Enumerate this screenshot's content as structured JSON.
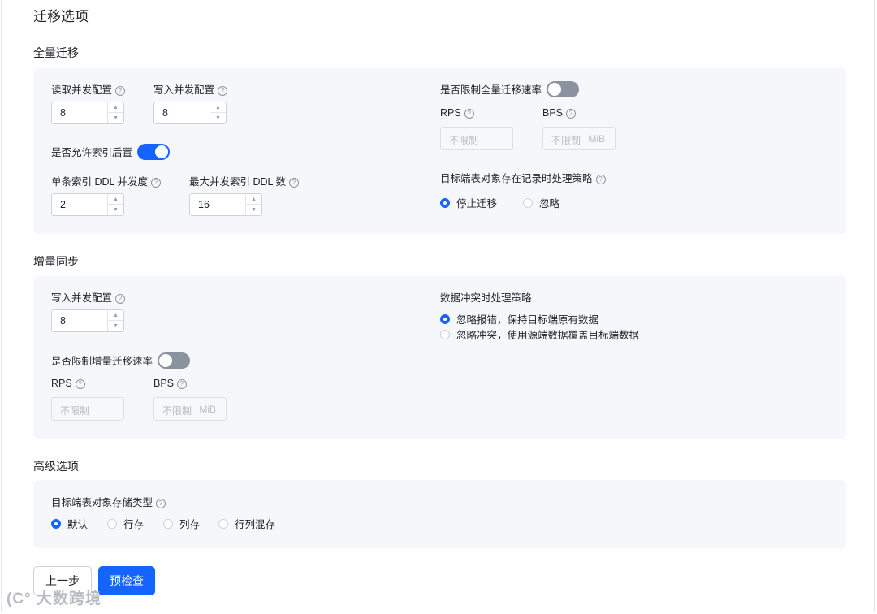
{
  "page_title": "迁移选项",
  "full": {
    "title": "全量迁移",
    "read_concurrency": {
      "label": "读取并发配置",
      "value": "8"
    },
    "write_concurrency": {
      "label": "写入并发配置",
      "value": "8"
    },
    "allow_index_defer": {
      "label": "是否允许索引后置",
      "enabled": true
    },
    "single_index_ddl": {
      "label": "单条索引 DDL 并发度",
      "value": "2"
    },
    "max_concurrent_ddl": {
      "label": "最大并发索引 DDL 数",
      "value": "16"
    },
    "limit_rate": {
      "label": "是否限制全量迁移速率",
      "enabled": false
    },
    "rps": {
      "label": "RPS",
      "placeholder": "不限制"
    },
    "bps": {
      "label": "BPS",
      "placeholder": "不限制",
      "unit": "MiB"
    },
    "existing_record_policy": {
      "label": "目标端表对象存在记录时处理策略",
      "options": [
        "停止迁移",
        "忽略"
      ],
      "selected": "停止迁移"
    }
  },
  "incremental": {
    "title": "增量同步",
    "write_concurrency": {
      "label": "写入并发配置",
      "value": "8"
    },
    "limit_rate": {
      "label": "是否限制增量迁移速率",
      "enabled": false
    },
    "rps": {
      "label": "RPS",
      "placeholder": "不限制"
    },
    "bps": {
      "label": "BPS",
      "placeholder": "不限制",
      "unit": "MiB"
    },
    "conflict_policy": {
      "label": "数据冲突时处理策略",
      "options": [
        "忽略报错，保持目标端原有数据",
        "忽略冲突，使用源端数据覆盖目标端数据"
      ],
      "selected": "忽略报错，保持目标端原有数据"
    }
  },
  "advanced": {
    "title": "高级选项",
    "storage_type": {
      "label": "目标端表对象存储类型",
      "options": [
        "默认",
        "行存",
        "列存",
        "行列混存"
      ],
      "selected": "默认"
    }
  },
  "buttons": {
    "prev": "上一步",
    "precheck": "预检查"
  },
  "watermark": "大数跨境",
  "colors": {
    "primary": "#1664ff",
    "panel_bg": "#f5f7fb",
    "toggle_off": "#8a919f"
  }
}
